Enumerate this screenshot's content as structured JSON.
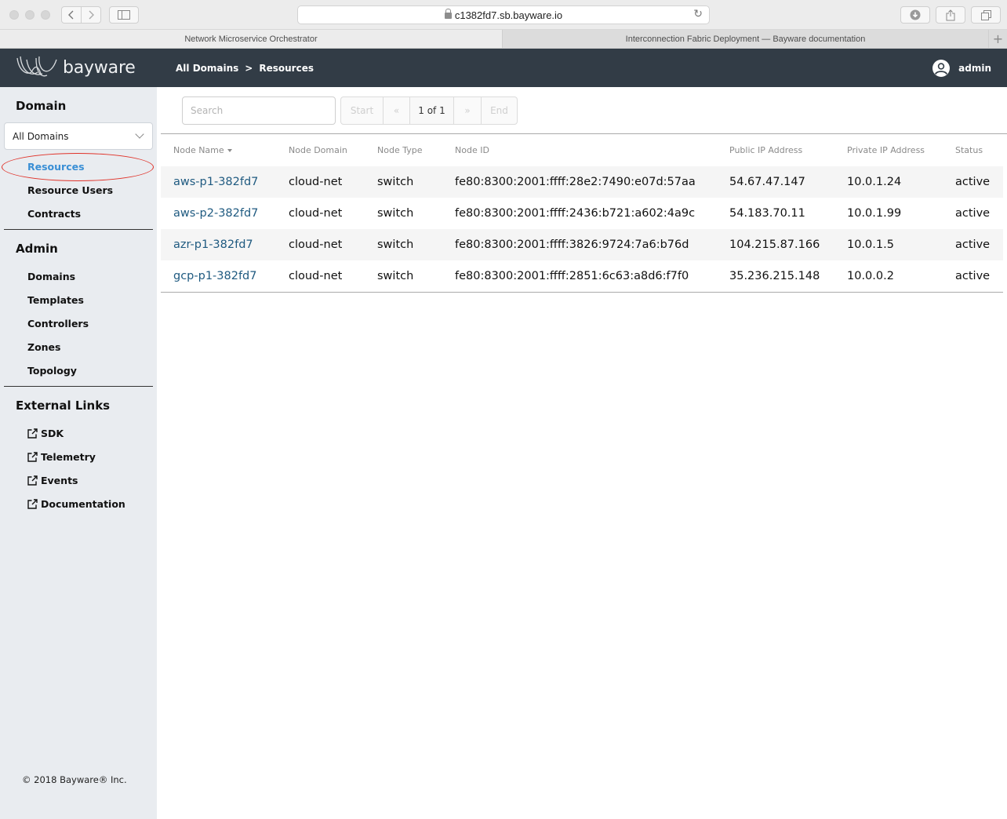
{
  "browser": {
    "url": "c1382fd7.sb.bayware.io",
    "tabs": [
      {
        "title": "Network Microservice Orchestrator",
        "active": true
      },
      {
        "title": "Interconnection Fabric Deployment — Bayware documentation",
        "active": false
      }
    ],
    "icons": {
      "back": "chevron-left-icon",
      "forward": "chevron-right-icon",
      "sidebar": "sidebar-icon",
      "reload": "reload-icon",
      "download": "download-icon",
      "share": "share-icon",
      "tabs": "tabs-icon",
      "new_tab": "plus-icon"
    }
  },
  "header": {
    "brand": "bayware",
    "breadcrumb": [
      "All Domains",
      "Resources"
    ],
    "breadcrumb_separator": ">",
    "user": "admin"
  },
  "sidebar": {
    "domain_heading": "Domain",
    "domain_select": "All Domains",
    "domain_items": [
      {
        "label": "Resources",
        "active": true
      },
      {
        "label": "Resource Users",
        "active": false
      },
      {
        "label": "Contracts",
        "active": false
      }
    ],
    "admin_heading": "Admin",
    "admin_items": [
      "Domains",
      "Templates",
      "Controllers",
      "Zones",
      "Topology"
    ],
    "external_heading": "External Links",
    "external_items": [
      "SDK",
      "Telemetry",
      "Events",
      "Documentation"
    ],
    "copyright": "© 2018 Bayware® Inc.",
    "active_color": "#3a8fd5",
    "annotation_color": "#e0332a"
  },
  "main": {
    "search_placeholder": "Search",
    "pager": {
      "start": "Start",
      "prev": "«",
      "page": "1 of 1",
      "next": "»",
      "end": "End"
    },
    "columns": [
      "Node Name",
      "Node Domain",
      "Node Type",
      "Node ID",
      "Public IP Address",
      "Private IP Address",
      "Status"
    ],
    "sorted_column": "Node Name",
    "rows": [
      {
        "name": "aws-p1-382fd7",
        "domain": "cloud-net",
        "type": "switch",
        "id": "fe80:8300:2001:ffff:28e2:7490:e07d:57aa",
        "public_ip": "54.67.47.147",
        "private_ip": "10.0.1.24",
        "status": "active"
      },
      {
        "name": "aws-p2-382fd7",
        "domain": "cloud-net",
        "type": "switch",
        "id": "fe80:8300:2001:ffff:2436:b721:a602:4a9c",
        "public_ip": "54.183.70.11",
        "private_ip": "10.0.1.99",
        "status": "active"
      },
      {
        "name": "azr-p1-382fd7",
        "domain": "cloud-net",
        "type": "switch",
        "id": "fe80:8300:2001:ffff:3826:9724:7a6:b76d",
        "public_ip": "104.215.87.166",
        "private_ip": "10.0.1.5",
        "status": "active"
      },
      {
        "name": "gcp-p1-382fd7",
        "domain": "cloud-net",
        "type": "switch",
        "id": "fe80:8300:2001:ffff:2851:6c63:a8d6:f7f0",
        "public_ip": "35.236.215.148",
        "private_ip": "10.0.0.2",
        "status": "active"
      }
    ],
    "link_color": "#1f5a80"
  }
}
